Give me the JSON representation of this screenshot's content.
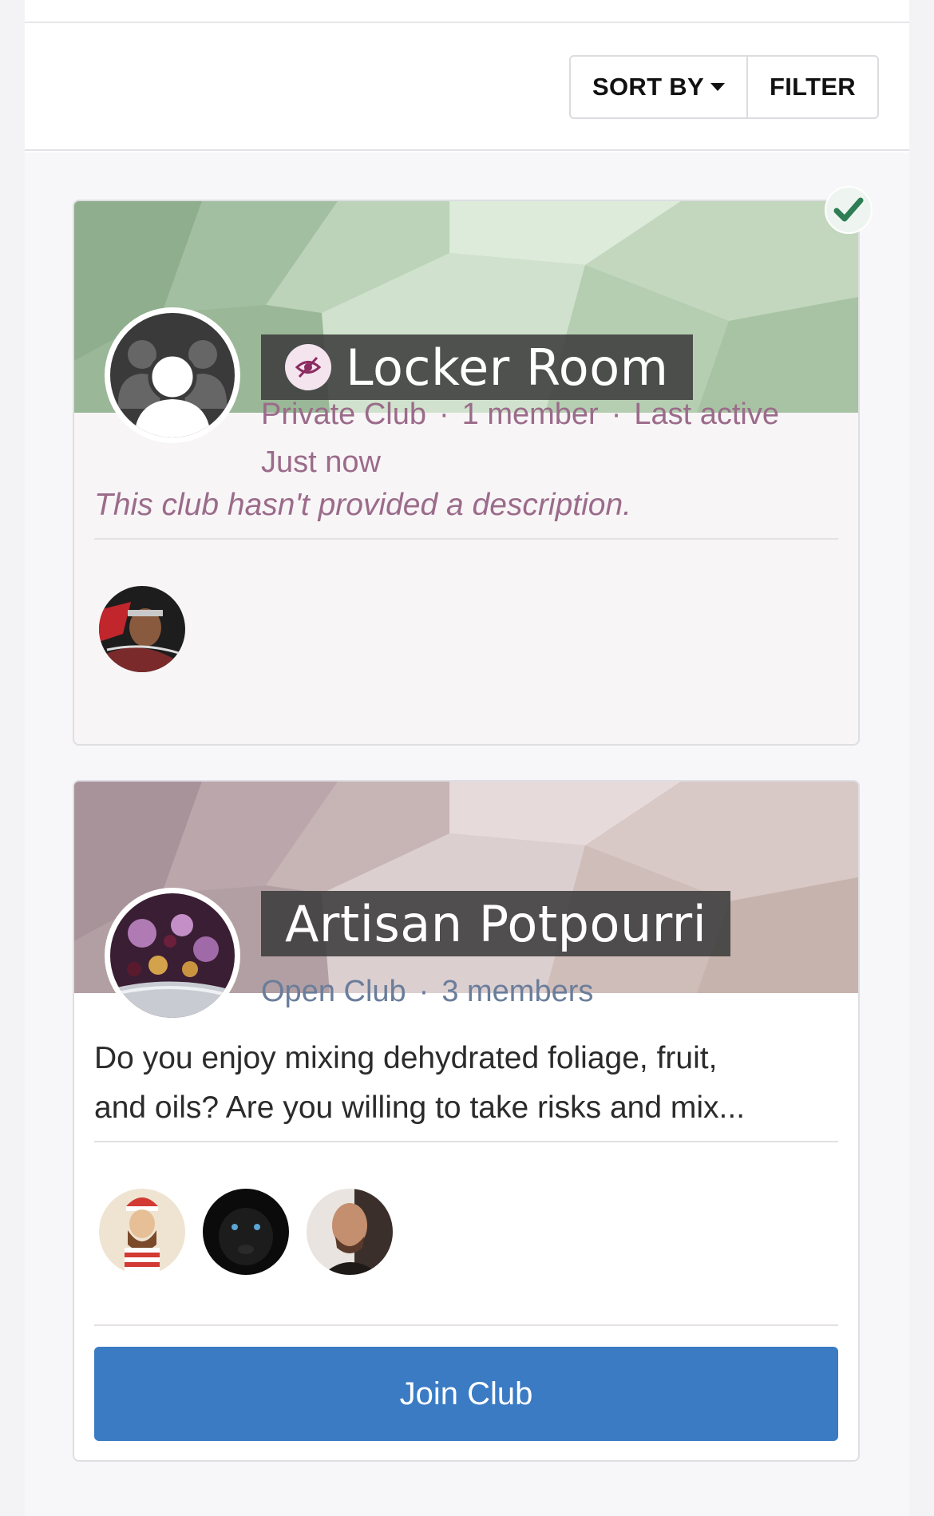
{
  "toolbar": {
    "sort_label": "SORT BY",
    "filter_label": "FILTER"
  },
  "clubs": [
    {
      "name": "Locker Room",
      "type": "Private Club",
      "members": "1 member",
      "last_active_label": "Last active",
      "last_active_value": "Just now",
      "description": "This club hasn't provided a description.",
      "joined": true,
      "visibility_icon": "eye-slash-icon",
      "avatar_icon": "group-icon",
      "member_avatar_count": 1
    },
    {
      "name": "Artisan Potpourri",
      "type": "Open Club",
      "members": "3 members",
      "description_line1": "Do you enjoy mixing dehydrated foliage, fruit,",
      "description_line2": "and oils? Are you willing to take risks and mix...",
      "join_label": "Join Club",
      "member_avatar_count": 3
    }
  ],
  "colors": {
    "private_text": "#9b6b8a",
    "open_text": "#6a7d9b",
    "join_button": "#3a7bc4",
    "check": "#2e7d54"
  }
}
